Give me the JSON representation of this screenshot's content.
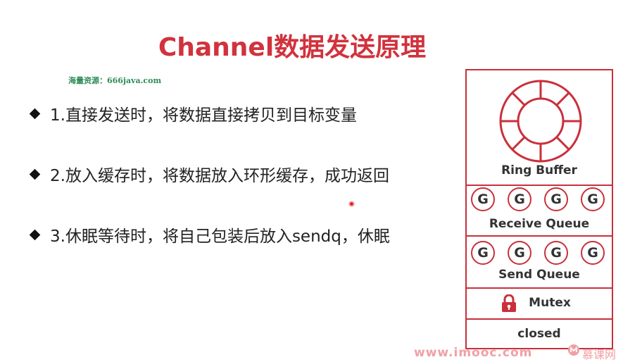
{
  "slide": {
    "title": "Channel数据发送原理",
    "source_note": "海量资源：666java.com"
  },
  "bullets": [
    {
      "text": "1.直接发送时，将数据直接拷贝到目标变量"
    },
    {
      "text": "2.放入缓存时，将数据放入环形缓存，成功返回"
    },
    {
      "text": "3.休眠等待时，将自己包装后放入sendq，休眠"
    }
  ],
  "diagram": {
    "ring_buffer_label": "Ring Buffer",
    "receive_queue": {
      "label": "Receive Queue",
      "items": [
        "G",
        "G",
        "G",
        "G"
      ]
    },
    "send_queue": {
      "label": "Send Queue",
      "items": [
        "G",
        "G",
        "G",
        "G"
      ]
    },
    "mutex_label": "Mutex",
    "closed_label": "closed",
    "accent_color": "#c9303b"
  },
  "footer": {
    "url": "www.imooc.com",
    "brand": "慕课网"
  },
  "icons": [
    "ring-buffer-icon",
    "lock-icon",
    "bullet-diamond-icon",
    "laser-pointer-icon",
    "imooc-logo-icon"
  ]
}
